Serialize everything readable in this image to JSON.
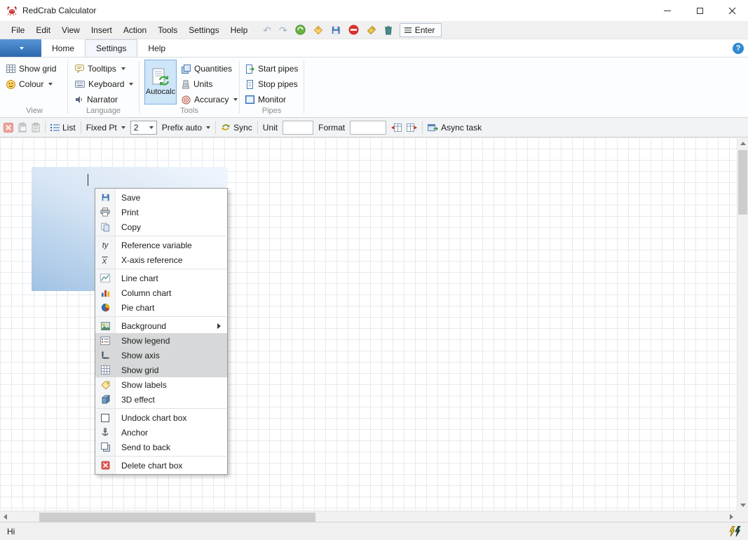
{
  "window": {
    "title": "RedCrab Calculator"
  },
  "menubar": {
    "items": [
      "File",
      "Edit",
      "View",
      "Insert",
      "Action",
      "Tools",
      "Settings",
      "Help"
    ],
    "enter": "Enter"
  },
  "icons": {
    "undo": "↶",
    "redo": "↷",
    "help": "?"
  },
  "tabs": {
    "home": "Home",
    "settings": "Settings",
    "help": "Help"
  },
  "ribbon": {
    "view": {
      "label": "View",
      "show_grid": "Show grid",
      "colour": "Colour"
    },
    "language": {
      "label": "Language",
      "tooltips": "Tooltips",
      "keyboard": "Keyboard",
      "narrator": "Narrator"
    },
    "tools": {
      "label": "Tools",
      "autocalc": "Autocalc",
      "quantities": "Quantities",
      "units": "Units",
      "accuracy": "Accuracy"
    },
    "pipes": {
      "label": "Pipes",
      "start": "Start pipes",
      "stop": "Stop pipes",
      "monitor": "Monitor"
    }
  },
  "toolbar": {
    "list": "List",
    "fixed_pt": "Fixed Pt",
    "precision": "2",
    "prefix": "Prefix auto",
    "sync": "Sync",
    "unit": "Unit",
    "unit_value": "",
    "format": "Format",
    "format_value": "",
    "async": "Async task"
  },
  "context_menu": {
    "save": "Save",
    "print": "Print",
    "copy": "Copy",
    "reference_variable": "Reference variable",
    "x_axis_reference": "X-axis reference",
    "line_chart": "Line chart",
    "column_chart": "Column chart",
    "pie_chart": "Pie chart",
    "background": "Background",
    "show_legend": "Show legend",
    "show_axis": "Show axis",
    "show_grid": "Show grid",
    "show_labels": "Show labels",
    "effect_3d": "3D effect",
    "undock_chart_box": "Undock chart box",
    "anchor": "Anchor",
    "send_to_back": "Send to back",
    "delete_chart_box": "Delete chart box"
  },
  "statusbar": {
    "text": "Hi"
  },
  "colors": {
    "accent_blue": "#2e6db4",
    "app_tab_blue": "#3d79bd",
    "autocalc_selected_bg": "#cfe5f8",
    "autocalc_selected_border": "#7eb2e2",
    "menu_checked_bg": "#d7d8d9",
    "chart_box_blue": "#a0c2e4",
    "delete_red": "#d9534f"
  }
}
